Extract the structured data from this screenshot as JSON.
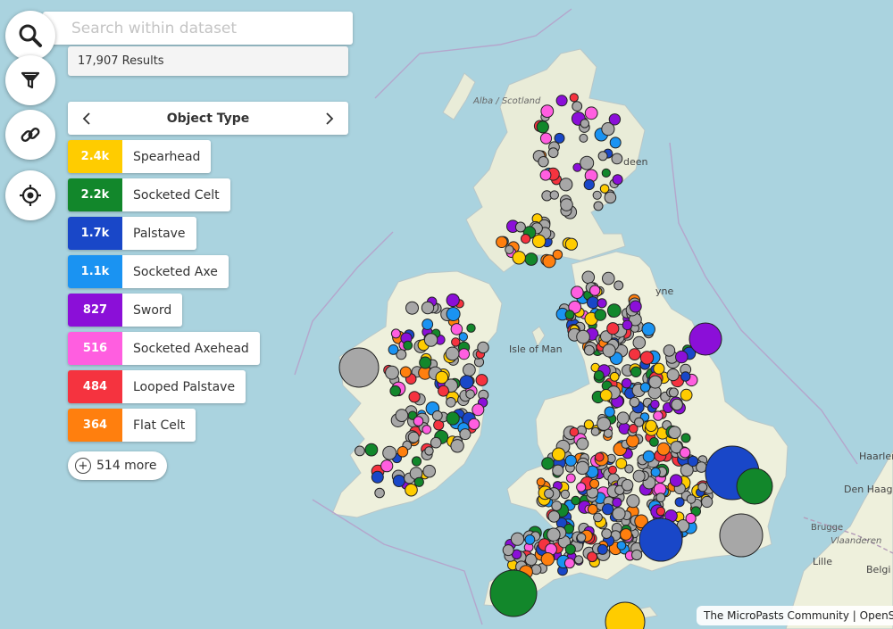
{
  "search": {
    "placeholder": "Search within dataset",
    "value": ""
  },
  "results": {
    "text": "17,907 Results"
  },
  "facet": {
    "title": "Object Type"
  },
  "facet_items": [
    {
      "count": "2.4k",
      "label": "Spearhead",
      "color": "#ffcc00"
    },
    {
      "count": "2.2k",
      "label": "Socketed Celt",
      "color": "#12872b"
    },
    {
      "count": "1.7k",
      "label": "Palstave",
      "color": "#1947c8"
    },
    {
      "count": "1.1k",
      "label": "Socketed Axe",
      "color": "#1a93f2"
    },
    {
      "count": "827",
      "label": "Sword",
      "color": "#8b0fd8"
    },
    {
      "count": "516",
      "label": "Socketed Axehead",
      "color": "#ff5ee0"
    },
    {
      "count": "484",
      "label": "Looped Palstave",
      "color": "#f5333f"
    },
    {
      "count": "364",
      "label": "Flat Celt",
      "color": "#ff7f0e"
    }
  ],
  "more": {
    "label": "514 more"
  },
  "other_color": "#a7a7a7",
  "tools": {
    "search": "search-icon",
    "filter": "filter-icon",
    "link": "link-icon",
    "locate": "locate-icon"
  },
  "map_labels": {
    "alba": "Alba / Scotland",
    "isle": "Isle of Man",
    "aberdeen": "deen",
    "newcastle": "yne",
    "haarlem": "Haarlem",
    "denhaag": "Den Haag",
    "brugge": "Brugge",
    "vlaanderen": "Vlaanderen",
    "lille": "Lille",
    "belgie": "Belgi"
  },
  "attribution": "The MicroPasts Community | OpenStreetMap"
}
